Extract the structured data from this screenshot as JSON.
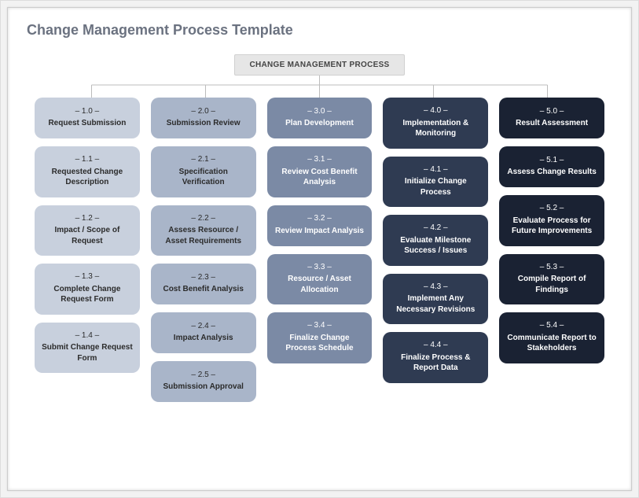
{
  "title": "Change Management Process Template",
  "root": "CHANGE MANAGEMENT PROCESS",
  "columns": [
    {
      "head_num": "– 1.0 –",
      "head_label": "Request Submission",
      "items": [
        {
          "num": "– 1.1 –",
          "label": "Requested Change Description"
        },
        {
          "num": "– 1.2 –",
          "label": "Impact / Scope of Request"
        },
        {
          "num": "– 1.3 –",
          "label": "Complete Change Request Form"
        },
        {
          "num": "– 1.4 –",
          "label": "Submit Change Request Form"
        }
      ]
    },
    {
      "head_num": "– 2.0 –",
      "head_label": "Submission Review",
      "items": [
        {
          "num": "– 2.1 –",
          "label": "Specification Verification"
        },
        {
          "num": "– 2.2 –",
          "label": "Assess Resource / Asset Requirements"
        },
        {
          "num": "– 2.3 –",
          "label": "Cost Benefit Analysis"
        },
        {
          "num": "– 2.4 –",
          "label": "Impact Analysis"
        },
        {
          "num": "– 2.5 –",
          "label": "Submission Approval"
        }
      ]
    },
    {
      "head_num": "– 3.0 –",
      "head_label": "Plan Development",
      "items": [
        {
          "num": "– 3.1 –",
          "label": "Review Cost Benefit Analysis"
        },
        {
          "num": "– 3.2 –",
          "label": "Review Impact Analysis"
        },
        {
          "num": "– 3.3 –",
          "label": "Resource / Asset Allocation"
        },
        {
          "num": "– 3.4 –",
          "label": "Finalize Change Process Schedule"
        }
      ]
    },
    {
      "head_num": "– 4.0 –",
      "head_label": "Implementation & Monitoring",
      "items": [
        {
          "num": "– 4.1 –",
          "label": "Initialize Change Process"
        },
        {
          "num": "– 4.2 –",
          "label": "Evaluate Milestone Success / Issues"
        },
        {
          "num": "– 4.3 –",
          "label": "Implement Any Necessary Revisions"
        },
        {
          "num": "– 4.4 –",
          "label": "Finalize Process & Report Data"
        }
      ]
    },
    {
      "head_num": "– 5.0 –",
      "head_label": "Result Assessment",
      "items": [
        {
          "num": "– 5.1 –",
          "label": "Assess Change Results"
        },
        {
          "num": "– 5.2 –",
          "label": "Evaluate Process for Future Improvements"
        },
        {
          "num": "– 5.3 –",
          "label": "Compile Report of Findings"
        },
        {
          "num": "– 5.4 –",
          "label": "Communicate Report to Stakeholders"
        }
      ]
    }
  ]
}
